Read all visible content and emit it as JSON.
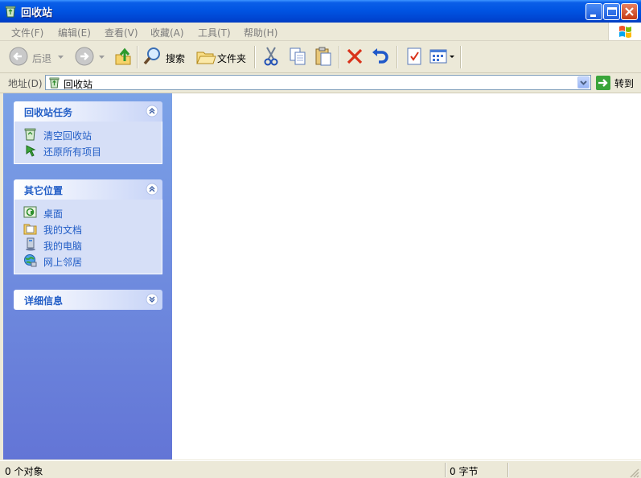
{
  "window": {
    "title": "回收站"
  },
  "menu": [
    "文件(F)",
    "编辑(E)",
    "查看(V)",
    "收藏(A)",
    "工具(T)",
    "帮助(H)"
  ],
  "toolbar": {
    "back": "后退",
    "search": "搜索",
    "folders": "文件夹"
  },
  "address": {
    "label": "地址(D)",
    "value": "回收站",
    "go": "转到"
  },
  "tasks": {
    "title": "回收站任务",
    "items": [
      "清空回收站",
      "还原所有项目"
    ]
  },
  "other_places": {
    "title": "其它位置",
    "items": [
      "桌面",
      "我的文档",
      "我的电脑",
      "网上邻居"
    ]
  },
  "details": {
    "title": "详细信息"
  },
  "status": {
    "objects": "0 个对象",
    "bytes": "0 字节"
  },
  "colors": {
    "title_bar": "#0053e1",
    "task_pane": "#6375d6",
    "link": "#215dc6"
  }
}
